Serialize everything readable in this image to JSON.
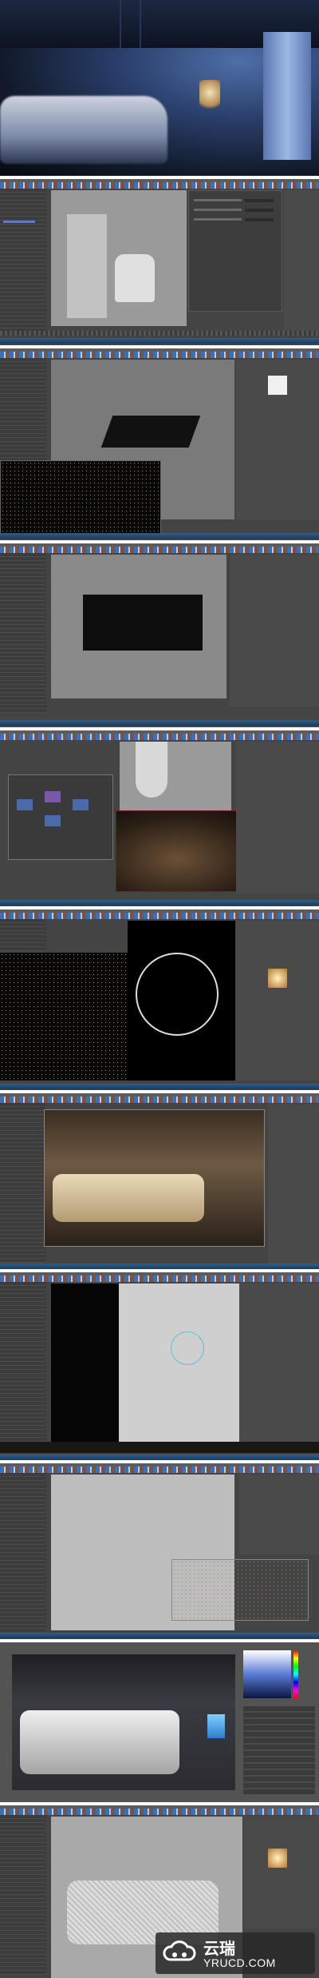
{
  "watermark": {
    "brand_cn": "云瑞",
    "brand_url": "YRUCD.COM"
  },
  "colors": {
    "maya_bg": "#444444",
    "maya_panel": "#4a4a4a",
    "viewport_grey": "#8f8f8f",
    "taskbar_blue": "#2f5e88",
    "selection_blue": "#5b7bbd"
  },
  "panels": [
    {
      "name": "hero-render",
      "type": "night-blue-bedroom-render"
    },
    {
      "name": "maya-armchair-view"
    },
    {
      "name": "maya-object-render"
    },
    {
      "name": "maya-bed-frame"
    },
    {
      "name": "maya-hypershade-lamp"
    },
    {
      "name": "maya-noisy-render-light"
    },
    {
      "name": "maya-warm-bedroom-render"
    },
    {
      "name": "maya-dark-wall-light"
    },
    {
      "name": "maya-viewport-noisy-render"
    },
    {
      "name": "photoshop-final-bedroom"
    },
    {
      "name": "maya-wireframe-bed"
    }
  ]
}
